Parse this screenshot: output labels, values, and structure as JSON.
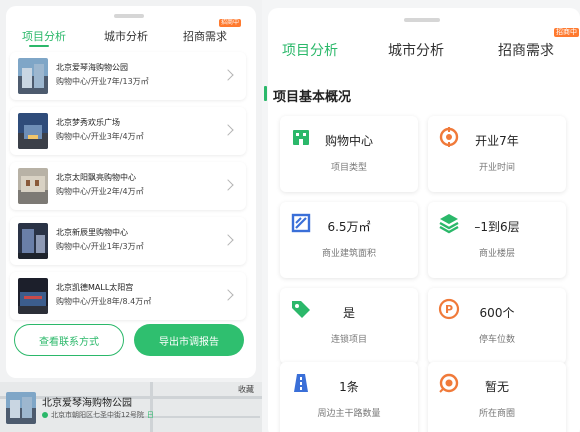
{
  "colors": {
    "accent": "#2bb86a",
    "badge": "#ff7a2f",
    "icon_green": "#2bb86a",
    "icon_blue": "#3a6fd8",
    "icon_orange": "#f07a3a"
  },
  "left": {
    "tabs": [
      {
        "label": "项目分析",
        "active": true
      },
      {
        "label": "城市分析",
        "active": false
      },
      {
        "label": "招商需求",
        "active": false
      }
    ],
    "tab_badge": "招商中",
    "malls": [
      {
        "name": "北京爱琴海购物公园",
        "desc": "购物中心/开业7年/13万㎡",
        "thumb": "mall-photo-1"
      },
      {
        "name": "北京梦秀欢乐广场",
        "desc": "购物中心/开业3年/4万㎡",
        "thumb": "mall-photo-2"
      },
      {
        "name": "北京太阳飘亮购物中心",
        "desc": "购物中心/开业2年/4万㎡",
        "thumb": "mall-photo-3"
      },
      {
        "name": "北京新辰里购物中心",
        "desc": "购物中心/开业1年/3万㎡",
        "thumb": "mall-photo-4"
      },
      {
        "name": "北京凯德MALL太阳宫",
        "desc": "购物中心/开业8年/8.4万㎡",
        "thumb": "mall-photo-5"
      }
    ],
    "buttons": {
      "contact": "查看联系方式",
      "export": "导出市调报告"
    },
    "map_card": {
      "title": "北京爱琴海购物公园",
      "address": "北京市朝阳区七圣中街12号院",
      "address_tail": "日"
    },
    "map_corner_text": "收藏"
  },
  "right": {
    "tabs": [
      {
        "label": "项目分析",
        "active": true
      },
      {
        "label": "城市分析",
        "active": false
      },
      {
        "label": "招商需求",
        "active": false
      }
    ],
    "tab_badge": "招商中",
    "section_title": "项目基本概况",
    "stats": [
      {
        "value": "购物中心",
        "label": "项目类型",
        "icon": "building-icon",
        "color": "#2bb86a"
      },
      {
        "value": "开业7年",
        "label": "开业时间",
        "icon": "target-icon",
        "color": "#f07a3a"
      },
      {
        "value": "6.5万㎡",
        "label": "商业建筑面积",
        "icon": "area-icon",
        "color": "#3a6fd8"
      },
      {
        "value": "–1到6层",
        "label": "商业楼层",
        "icon": "layers-icon",
        "color": "#2bb86a"
      },
      {
        "value": "是",
        "label": "连锁项目",
        "icon": "tag-icon",
        "color": "#2bb86a"
      },
      {
        "value": "600个",
        "label": "停车位数",
        "icon": "parking-icon",
        "color": "#f07a3a"
      },
      {
        "value": "1条",
        "label": "周边主干路数量",
        "icon": "road-icon",
        "color": "#3a6fd8"
      },
      {
        "value": "暂无",
        "label": "所在商圈",
        "icon": "business-district-icon",
        "color": "#f07a3a"
      }
    ]
  }
}
